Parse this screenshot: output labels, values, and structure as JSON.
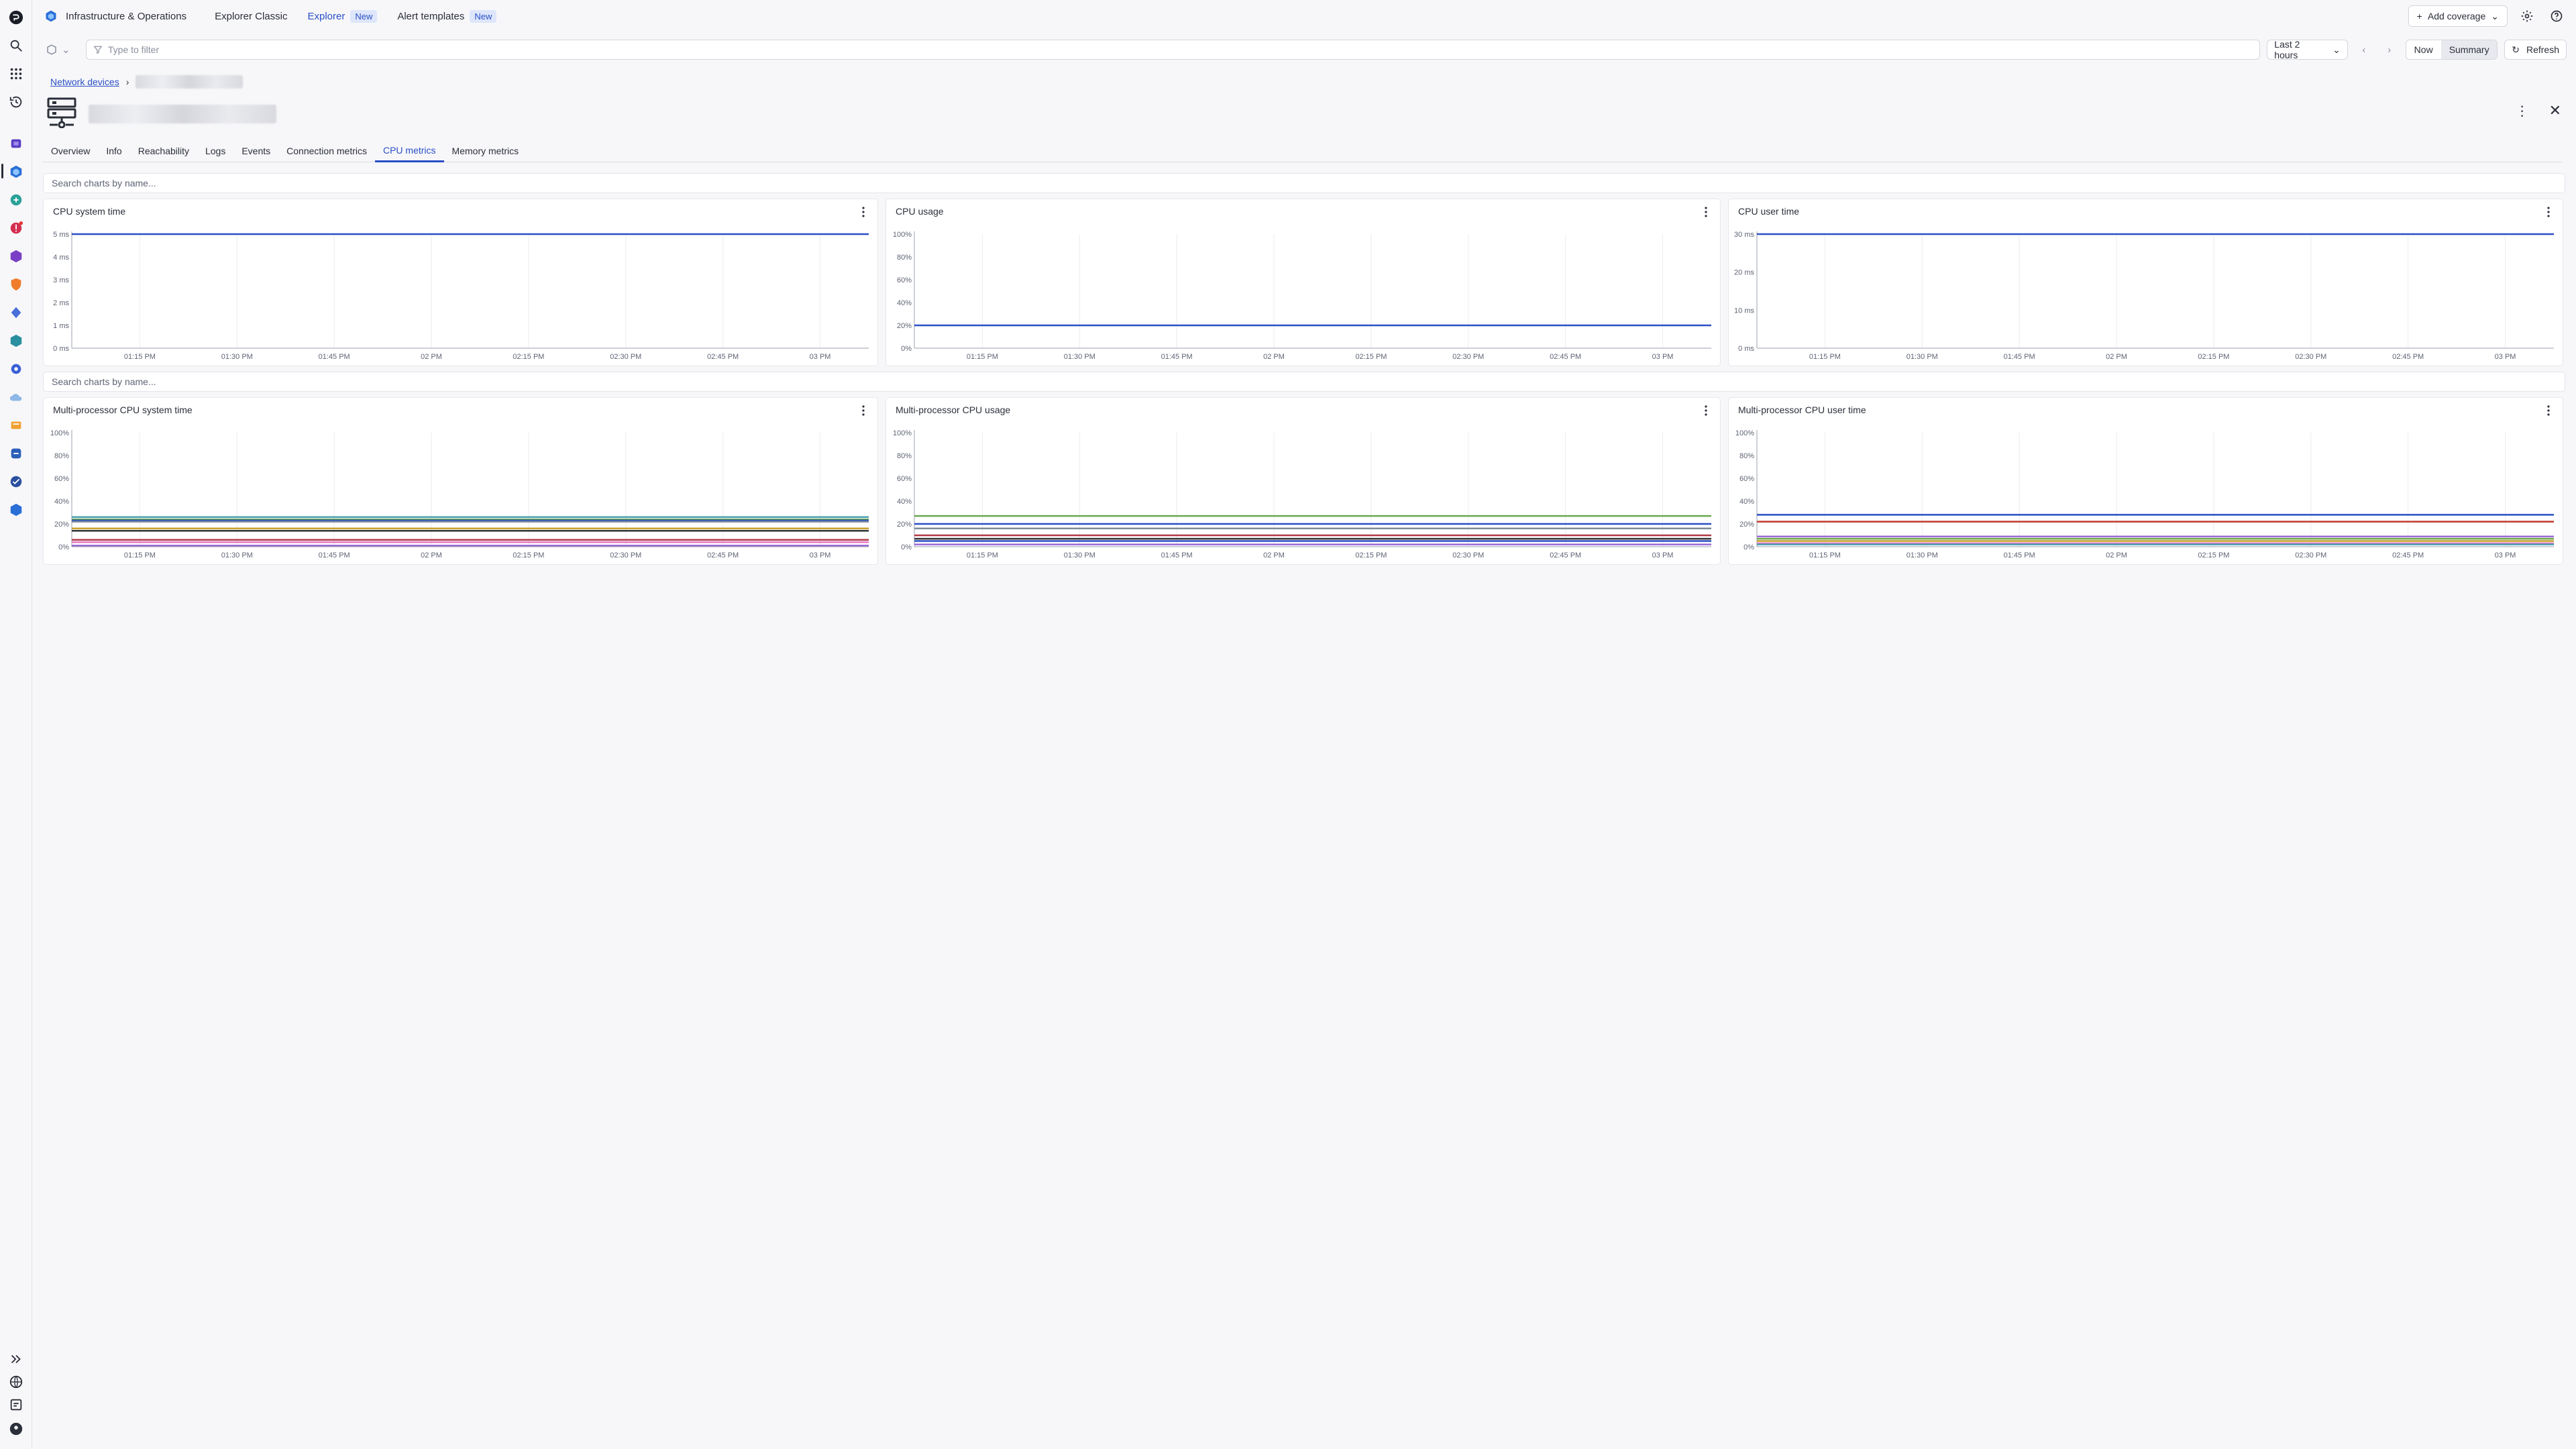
{
  "app": {
    "title": "Infrastructure & Operations",
    "tabs": [
      {
        "label": "Explorer Classic",
        "badge": ""
      },
      {
        "label": "Explorer",
        "badge": "New"
      },
      {
        "label": "Alert templates",
        "badge": "New"
      }
    ],
    "add_coverage": "Add coverage"
  },
  "filter": {
    "placeholder": "Type to filter",
    "timeframe": "Last 2 hours",
    "now": "Now",
    "summary": "Summary",
    "refresh": "Refresh"
  },
  "breadcrumb": {
    "parent": "Network devices"
  },
  "tabs": [
    "Overview",
    "Info",
    "Reachability",
    "Logs",
    "Events",
    "Connection metrics",
    "CPU metrics",
    "Memory metrics"
  ],
  "active_tab": "CPU metrics",
  "search": {
    "placeholder": "Search charts by name..."
  },
  "colors": {
    "accent": "#2a4fc6",
    "series_primary": "#2a4fc6"
  },
  "chart_data": [
    {
      "type": "line",
      "title": "CPU system time",
      "x": [
        "01:15 PM",
        "01:30 PM",
        "01:45 PM",
        "02 PM",
        "02:15 PM",
        "02:30 PM",
        "02:45 PM",
        "03 PM"
      ],
      "yticks": [
        "0 ms",
        "1 ms",
        "2 ms",
        "3 ms",
        "4 ms",
        "5 ms"
      ],
      "ylim": [
        0,
        5
      ],
      "series": [
        {
          "values": [
            5,
            5,
            5,
            5,
            5,
            5,
            5,
            5,
            5
          ],
          "color": "#2a4fc6"
        }
      ]
    },
    {
      "type": "line",
      "title": "CPU usage",
      "x": [
        "01:15 PM",
        "01:30 PM",
        "01:45 PM",
        "02 PM",
        "02:15 PM",
        "02:30 PM",
        "02:45 PM",
        "03 PM"
      ],
      "yticks": [
        "0%",
        "20%",
        "40%",
        "60%",
        "80%",
        "100%"
      ],
      "ylim": [
        0,
        100
      ],
      "series": [
        {
          "values": [
            20,
            20,
            20,
            20,
            20,
            20,
            20,
            20,
            20
          ],
          "color": "#2a4fc6"
        }
      ]
    },
    {
      "type": "line",
      "title": "CPU user time",
      "x": [
        "01:15 PM",
        "01:30 PM",
        "01:45 PM",
        "02 PM",
        "02:15 PM",
        "02:30 PM",
        "02:45 PM",
        "03 PM"
      ],
      "yticks": [
        "0 ms",
        "10 ms",
        "20 ms",
        "30 ms"
      ],
      "ylim": [
        0,
        30
      ],
      "series": [
        {
          "values": [
            30,
            30,
            30,
            30,
            30,
            30,
            30,
            30,
            30
          ],
          "color": "#2a4fc6"
        }
      ]
    },
    {
      "type": "line",
      "title": "Multi-processor CPU system time",
      "x": [
        "01:15 PM",
        "01:30 PM",
        "01:45 PM",
        "02 PM",
        "02:15 PM",
        "02:30 PM",
        "02:45 PM",
        "03 PM"
      ],
      "yticks": [
        "0%",
        "20%",
        "40%",
        "60%",
        "80%",
        "100%"
      ],
      "ylim": [
        0,
        100
      ],
      "series": [
        {
          "values": [
            26,
            26,
            26,
            26,
            26,
            26,
            26,
            26,
            26
          ],
          "color": "#4a9fb0"
        },
        {
          "values": [
            24,
            24,
            24,
            24,
            24,
            24,
            24,
            24,
            24
          ],
          "color": "#6aa84f"
        },
        {
          "values": [
            23,
            23,
            23,
            23,
            23,
            23,
            23,
            23,
            23
          ],
          "color": "#2a4fc6"
        },
        {
          "values": [
            22,
            22,
            22,
            22,
            22,
            22,
            22,
            22,
            22
          ],
          "color": "#7c8b99"
        },
        {
          "values": [
            16,
            16,
            16,
            16,
            16,
            16,
            16,
            16,
            16
          ],
          "color": "#c9a227"
        },
        {
          "values": [
            14,
            14,
            14,
            14,
            14,
            14,
            14,
            14,
            14
          ],
          "color": "#333333"
        },
        {
          "values": [
            6,
            6,
            6,
            6,
            6,
            6,
            6,
            6,
            6
          ],
          "color": "#b23a48"
        },
        {
          "values": [
            4,
            4,
            4,
            4,
            4,
            4,
            4,
            4,
            4
          ],
          "color": "#e377c2"
        },
        {
          "values": [
            1,
            1,
            1,
            1,
            1,
            1,
            1,
            1,
            1
          ],
          "color": "#9c6ad6"
        }
      ]
    },
    {
      "type": "line",
      "title": "Multi-processor CPU usage",
      "x": [
        "01:15 PM",
        "01:30 PM",
        "01:45 PM",
        "02 PM",
        "02:15 PM",
        "02:30 PM",
        "02:45 PM",
        "03 PM"
      ],
      "yticks": [
        "0%",
        "20%",
        "40%",
        "60%",
        "80%",
        "100%"
      ],
      "ylim": [
        0,
        100
      ],
      "series": [
        {
          "values": [
            27,
            27,
            27,
            27,
            27,
            27,
            27,
            27,
            27
          ],
          "color": "#6aa84f"
        },
        {
          "values": [
            20,
            20,
            20,
            20,
            20,
            20,
            20,
            20,
            20
          ],
          "color": "#2a4fc6"
        },
        {
          "values": [
            16,
            16,
            16,
            16,
            16,
            16,
            16,
            16,
            16
          ],
          "color": "#7c8b99"
        },
        {
          "values": [
            10,
            10,
            10,
            10,
            10,
            10,
            10,
            10,
            10
          ],
          "color": "#b23a48"
        },
        {
          "values": [
            7,
            7,
            7,
            7,
            7,
            7,
            7,
            7,
            7
          ],
          "color": "#333333"
        },
        {
          "values": [
            5,
            5,
            5,
            5,
            5,
            5,
            5,
            5,
            5
          ],
          "color": "#2a4fc6"
        },
        {
          "values": [
            2,
            2,
            2,
            2,
            2,
            2,
            2,
            2,
            2
          ],
          "color": "#9c6ad6"
        }
      ]
    },
    {
      "type": "line",
      "title": "Multi-processor CPU user time",
      "x": [
        "01:15 PM",
        "01:30 PM",
        "01:45 PM",
        "02 PM",
        "02:15 PM",
        "02:30 PM",
        "02:45 PM",
        "03 PM"
      ],
      "yticks": [
        "0%",
        "20%",
        "40%",
        "60%",
        "80%",
        "100%"
      ],
      "ylim": [
        0,
        100
      ],
      "series": [
        {
          "values": [
            28,
            28,
            28,
            28,
            28,
            28,
            28,
            28,
            28
          ],
          "color": "#2a4fc6"
        },
        {
          "values": [
            22,
            22,
            22,
            22,
            22,
            22,
            22,
            22,
            22
          ],
          "color": "#c0392b"
        },
        {
          "values": [
            9,
            9,
            9,
            9,
            9,
            9,
            9,
            9,
            9
          ],
          "color": "#9c6ad6"
        },
        {
          "values": [
            7,
            7,
            7,
            7,
            7,
            7,
            7,
            7,
            7
          ],
          "color": "#6aa84f"
        },
        {
          "values": [
            5,
            5,
            5,
            5,
            5,
            5,
            5,
            5,
            5
          ],
          "color": "#c9a227"
        },
        {
          "values": [
            3,
            3,
            3,
            3,
            3,
            3,
            3,
            3,
            3
          ],
          "color": "#e377c2"
        },
        {
          "values": [
            2,
            2,
            2,
            2,
            2,
            2,
            2,
            2,
            2
          ],
          "color": "#4a9fb0"
        }
      ]
    }
  ]
}
